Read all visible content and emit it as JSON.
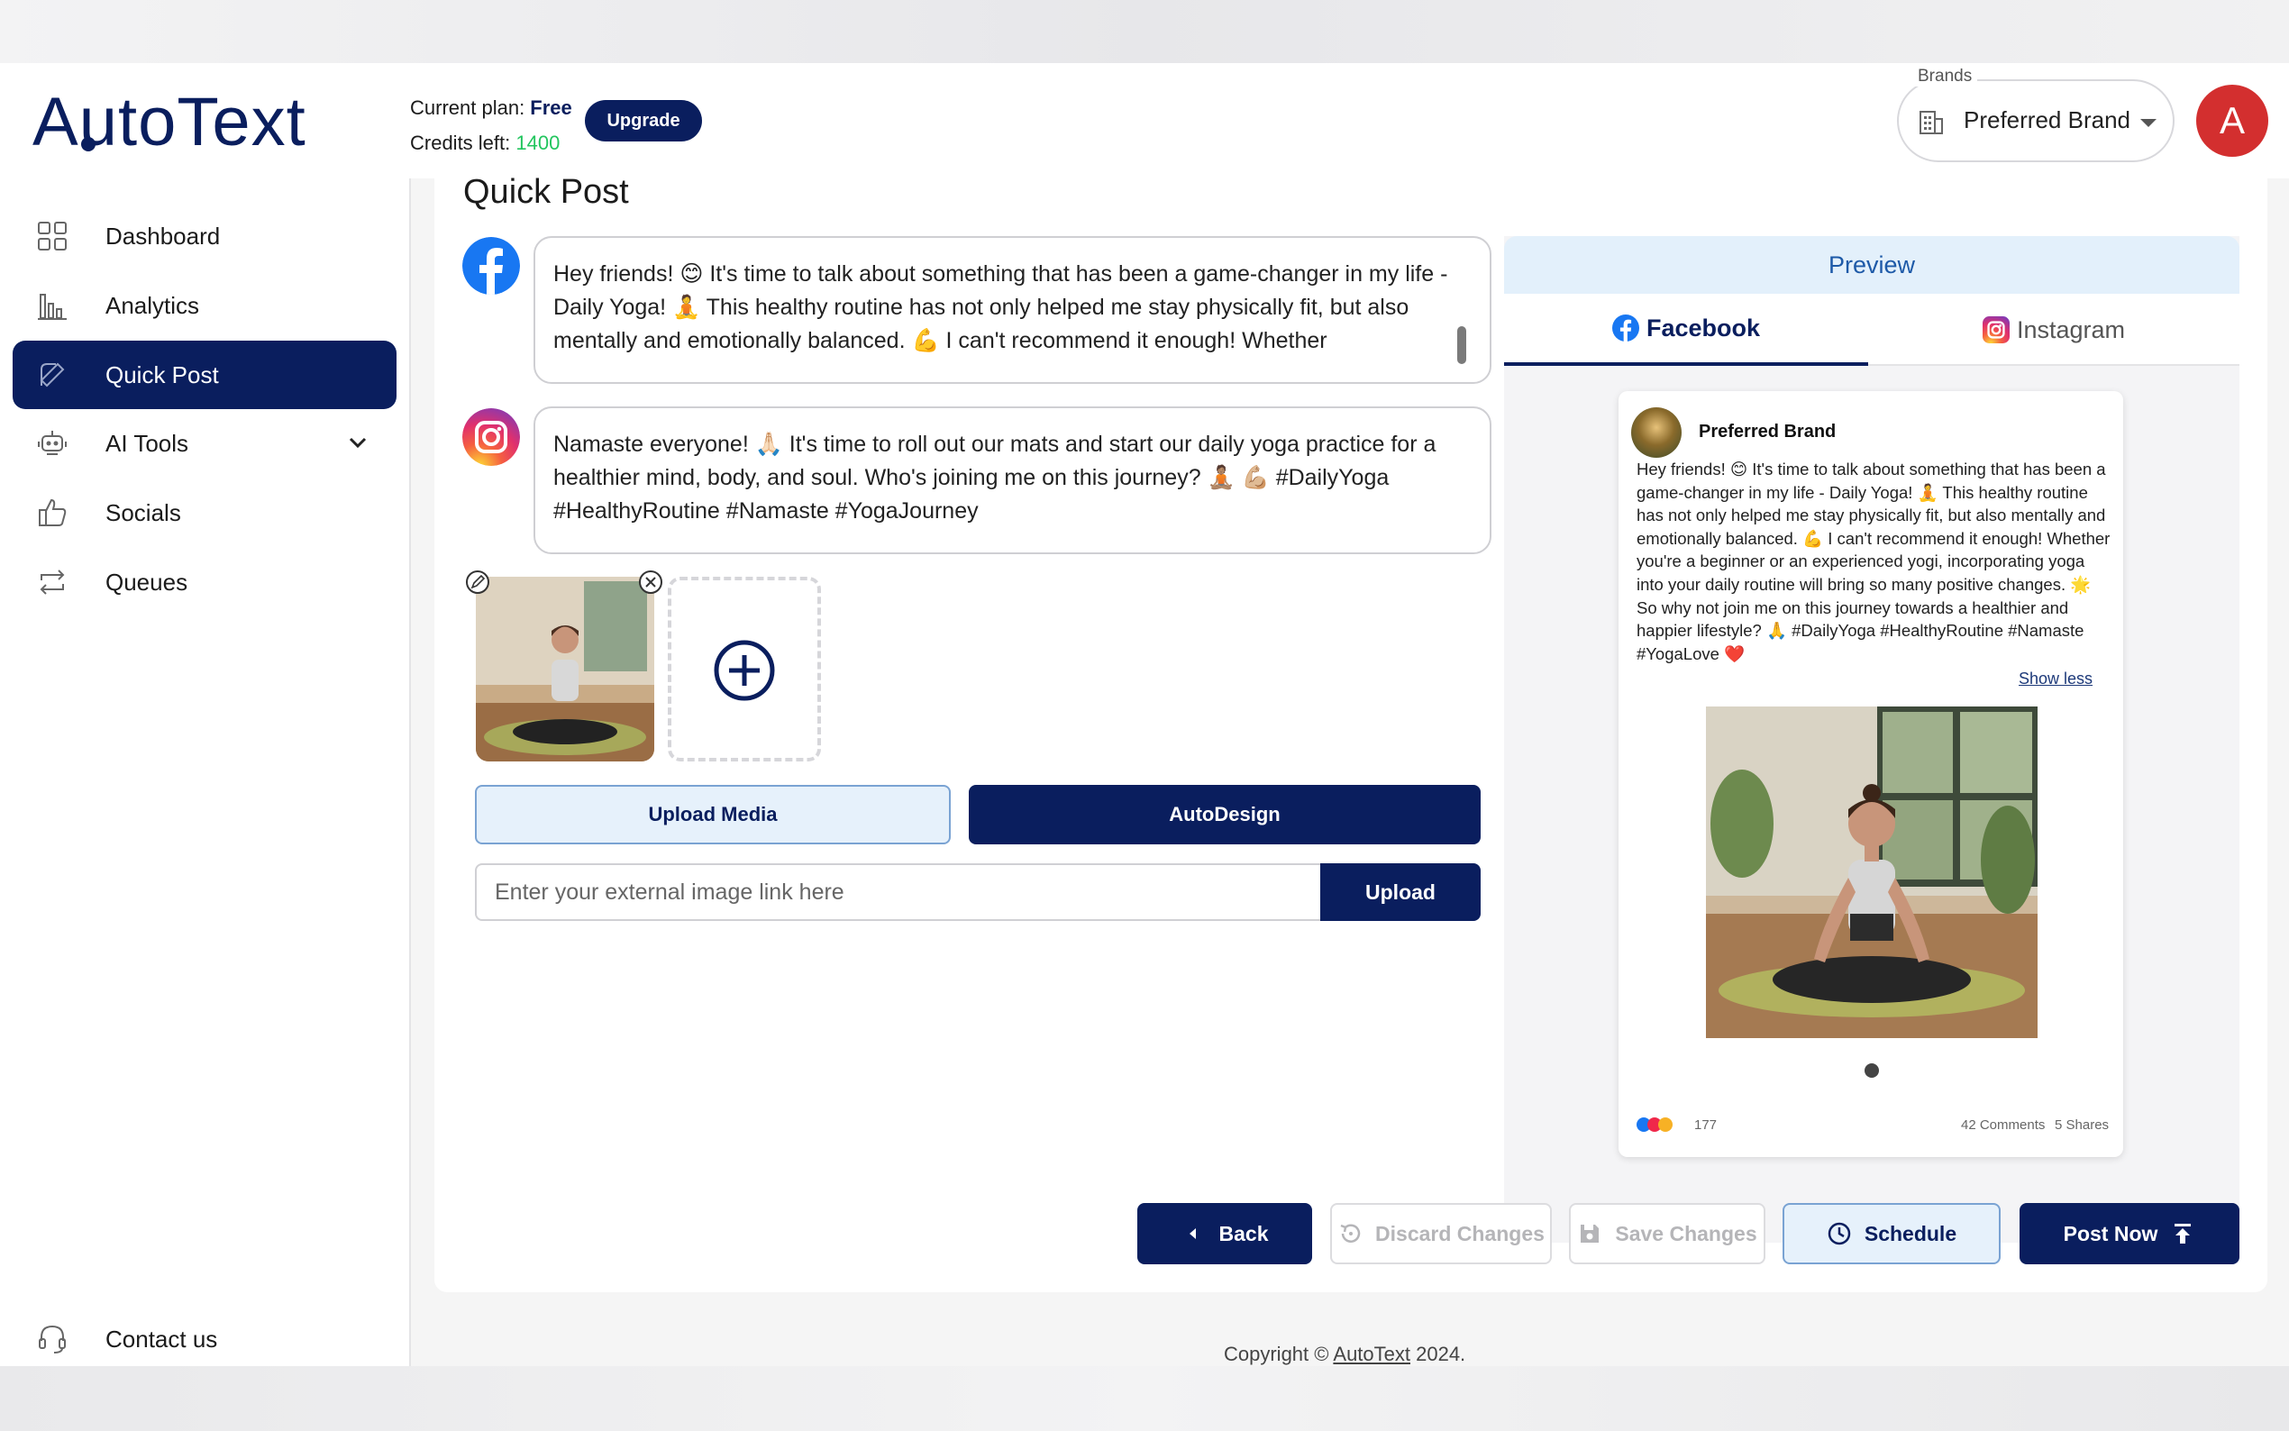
{
  "app": {
    "logo": "AutoText"
  },
  "header": {
    "plan_label": "Current plan: ",
    "plan_value": "Free",
    "credits_label": "Credits left: ",
    "credits_value": "1400",
    "upgrade_label": "Upgrade",
    "brands_legend": "Brands",
    "brand_selected": "Preferred Brand",
    "avatar_letter": "A"
  },
  "sidebar": {
    "items": [
      {
        "label": "Dashboard",
        "icon": "grid-icon"
      },
      {
        "label": "Analytics",
        "icon": "bar-chart-icon"
      },
      {
        "label": "Quick Post",
        "icon": "edit-post-icon",
        "active": true
      },
      {
        "label": "AI Tools",
        "icon": "robot-icon"
      },
      {
        "label": "Socials",
        "icon": "thumbs-up-icon"
      },
      {
        "label": "Queues",
        "icon": "repeat-icon"
      }
    ],
    "contact_label": "Contact us"
  },
  "main": {
    "title": "Quick Post",
    "facebook_text": "Hey friends! 😊 It's time to talk about something that has been a game-changer in my life - Daily Yoga! 🧘 This healthy routine has not only helped me stay physically fit, but also mentally and emotionally balanced. 💪 I can't recommend it enough! Whether",
    "instagram_text": "Namaste everyone! 🙏🏻 It's time to roll out our mats and start our daily yoga practice for a healthier mind, body, and soul. Who's joining me on this journey? 🧘🏽 💪🏼 #DailyYoga #HealthyRoutine #Namaste #YogaJourney",
    "upload_media_label": "Upload Media",
    "autodesign_label": "AutoDesign",
    "external_placeholder": "Enter your external image link here",
    "upload_label": "Upload"
  },
  "preview": {
    "heading": "Preview",
    "tab_facebook": "Facebook",
    "tab_instagram": "Instagram",
    "post_brand": "Preferred Brand",
    "post_text": "Hey friends! 😊 It's time to talk about something that has been a game-changer in my life - Daily Yoga! 🧘 This healthy routine has not only helped me stay physically fit, but also mentally and emotionally balanced. 💪 I can't recommend it enough! Whether you're a beginner or an experienced yogi, incorporating yoga into your daily routine will bring so many positive changes. 🌟 So why not join me on this journey towards a healthier and happier lifestyle? 🙏 #DailyYoga #HealthyRoutine #Namaste #YogaLove ❤️",
    "show_less": "Show less",
    "reactions": "177",
    "comments": "42 Comments",
    "shares": "5 Shares"
  },
  "actions": {
    "back": "Back",
    "discard": "Discard Changes",
    "save": "Save Changes",
    "schedule": "Schedule",
    "post_now": "Post Now"
  },
  "footer": {
    "copyright_prefix": "Copyright © ",
    "brand_link": "AutoText",
    "year_suffix": " 2024."
  },
  "colors": {
    "primary": "#0a1e5e",
    "credits_green": "#22c55e",
    "avatar_red": "#d32f2f",
    "preview_blue": "#1e5aa8"
  }
}
